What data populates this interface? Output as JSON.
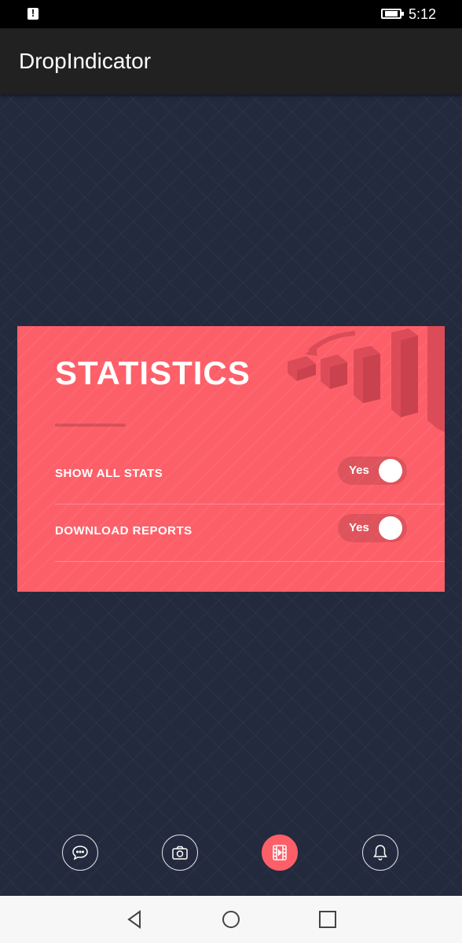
{
  "status_bar": {
    "time": "5:12",
    "alert_icon": "alert-icon",
    "battery_icon": "battery-charging-icon"
  },
  "app_bar": {
    "title": "DropIndicator"
  },
  "card": {
    "title": "STATISTICS",
    "background_color": "#fd5f69",
    "decoration_icon": "bar-chart-icon",
    "settings": [
      {
        "label": "SHOW ALL STATS",
        "toggle_text": "Yes",
        "enabled": true
      },
      {
        "label": "DOWNLOAD REPORTS",
        "toggle_text": "Yes",
        "enabled": true
      }
    ]
  },
  "bottom_nav": {
    "items": [
      {
        "icon": "chat-bubble-icon",
        "active": false
      },
      {
        "icon": "camera-icon",
        "active": false
      },
      {
        "icon": "film-icon",
        "active": true
      },
      {
        "icon": "bell-icon",
        "active": false
      }
    ],
    "accent_color": "#fd5f69"
  },
  "system_nav": {
    "items": [
      "back-icon",
      "home-icon",
      "recents-icon"
    ]
  }
}
